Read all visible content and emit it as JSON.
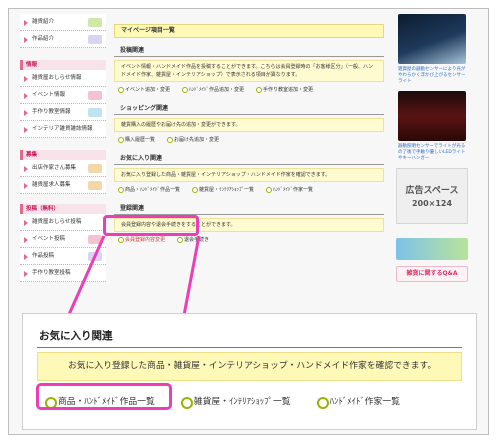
{
  "sidebar": {
    "top_items": [
      {
        "label": "雑貨紹介"
      },
      {
        "label": "作品紹介"
      }
    ],
    "info": {
      "heading": "情報",
      "items": [
        {
          "label": "雑貨屋おしらせ情報"
        },
        {
          "label": "イベント情報"
        },
        {
          "label": "手作り教室情報"
        },
        {
          "label": "インテリア雑貨雑誌情報"
        }
      ]
    },
    "recruit": {
      "heading": "募集",
      "items": [
        {
          "label": "出店作家さん募集"
        },
        {
          "label": "雑貨屋求人募集"
        }
      ]
    },
    "post": {
      "heading": "投稿（無料）",
      "items": [
        {
          "label": "雑貨屋おしらせ投稿"
        },
        {
          "label": "イベント投稿"
        },
        {
          "label": "作品投稿"
        },
        {
          "label": "手作り教室投稿"
        }
      ]
    }
  },
  "main": {
    "title": "マイページ項目一覧",
    "sections": [
      {
        "title": "投稿関連",
        "desc": "イベント情報・ハンドメイド作品を投稿することができます。こちらは会員登録時の「お客様区分」（一般、ハンドメイド作家、雑貨屋・インテリアショップ）で表示される項目が異なります。",
        "links": [
          "イベント追加・変更",
          "ﾊﾝﾄﾞﾒｲﾄﾞ作品追加・変更",
          "手作り教室追加・変更"
        ]
      },
      {
        "title": "ショッピング関連",
        "desc": "雑貨購入の履歴やお届け先の追加・変更ができます。",
        "links": [
          "購入履歴一覧",
          "お届け先追加・変更"
        ]
      },
      {
        "title": "お気に入り関連",
        "desc": "お気に入り登録した商品・雑貨屋・インテリアショップ・ハンドメイド作家を確認できます。",
        "links": [
          "商品・ﾊﾝﾄﾞﾒｲﾄﾞ作品一覧",
          "雑貨屋・ｲﾝﾃﾘｱｼｮｯﾌﾟ一覧",
          "ﾊﾝﾄﾞﾒｲﾄﾞ作家一覧"
        ]
      },
      {
        "title": "登録関連",
        "desc": "会員登録内容や退会手続きをすることができます。",
        "links": [
          "会員登録内容変更",
          "退会手続き"
        ]
      }
    ]
  },
  "right": {
    "caption1": "雑貨屋の器動センサーにより光がやわらかく浮かび上がるセンサーライト",
    "caption2": "器動照明センサーでライトが光るの了後で手触り優しいLEDライトやキーハンガー",
    "ad_line1": "広告スペース",
    "ad_line2": "200×124",
    "banner2_text": "雑貨に関するQ&A"
  },
  "zoom": {
    "title": "お気に入り関連",
    "desc": "お気に入り登録した商品・雑貨屋・インテリアショップ・ハンドメイド作家を確認できます。",
    "links": [
      "商品・ﾊﾝﾄﾞﾒｲﾄﾞ作品一覧",
      "雑貨屋・ｲﾝﾃﾘｱｼｮｯﾌﾟ一覧",
      "ﾊﾝﾄﾞﾒｲﾄﾞ作家一覧"
    ]
  },
  "colors": {
    "accent_pink": "#e06b8b",
    "highlight_magenta": "#ea3fb7",
    "yellow_panel": "#fff9b8",
    "bullet_green": "#99b300"
  }
}
